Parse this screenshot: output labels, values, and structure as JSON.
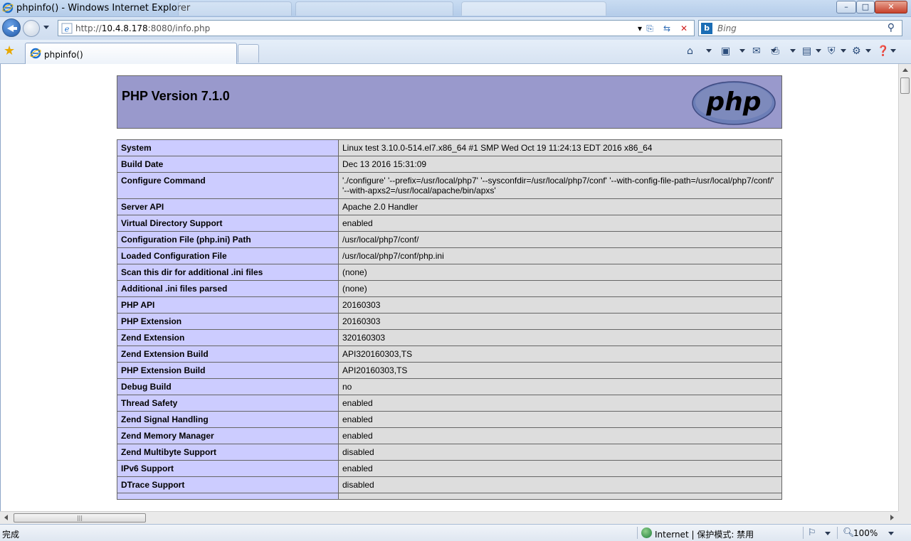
{
  "window": {
    "title": "phpinfo() - Windows Internet Explorer",
    "minimize": "–",
    "maximize": "□",
    "close": "✕"
  },
  "address_bar": {
    "url_prefix": "http://",
    "url_host": "10.4.8.178",
    "url_rest": ":8080/info.php"
  },
  "search": {
    "placeholder": "Bing",
    "provider_icon": "b"
  },
  "tabs": [
    {
      "label": "phpinfo()",
      "active": true
    }
  ],
  "page": {
    "php_version": "PHP Version 7.1.0",
    "logo_text": "php",
    "rows": [
      {
        "key": "System",
        "value": "Linux test 3.10.0-514.el7.x86_64 #1 SMP Wed Oct 19 11:24:13 EDT 2016 x86_64"
      },
      {
        "key": "Build Date",
        "value": "Dec 13 2016 15:31:09"
      },
      {
        "key": "Configure Command",
        "value": "'./configure' '--prefix=/usr/local/php7' '--sysconfdir=/usr/local/php7/conf' '--with-config-file-path=/usr/local/php7/conf/' '--with-apxs2=/usr/local/apache/bin/apxs'"
      },
      {
        "key": "Server API",
        "value": "Apache 2.0 Handler"
      },
      {
        "key": "Virtual Directory Support",
        "value": "enabled"
      },
      {
        "key": "Configuration File (php.ini) Path",
        "value": "/usr/local/php7/conf/"
      },
      {
        "key": "Loaded Configuration File",
        "value": "/usr/local/php7/conf/php.ini"
      },
      {
        "key": "Scan this dir for additional .ini files",
        "value": "(none)"
      },
      {
        "key": "Additional .ini files parsed",
        "value": "(none)"
      },
      {
        "key": "PHP API",
        "value": "20160303"
      },
      {
        "key": "PHP Extension",
        "value": "20160303"
      },
      {
        "key": "Zend Extension",
        "value": "320160303"
      },
      {
        "key": "Zend Extension Build",
        "value": "API320160303,TS"
      },
      {
        "key": "PHP Extension Build",
        "value": "API20160303,TS"
      },
      {
        "key": "Debug Build",
        "value": "no"
      },
      {
        "key": "Thread Safety",
        "value": "enabled"
      },
      {
        "key": "Zend Signal Handling",
        "value": "enabled"
      },
      {
        "key": "Zend Memory Manager",
        "value": "enabled"
      },
      {
        "key": "Zend Multibyte Support",
        "value": "disabled"
      },
      {
        "key": "IPv6 Support",
        "value": "enabled"
      },
      {
        "key": "DTrace Support",
        "value": "disabled"
      },
      {
        "key": "",
        "value": ""
      }
    ]
  },
  "statusbar": {
    "status": "完成",
    "zone": "Internet | 保护模式: 禁用",
    "zoom": "100%"
  },
  "colors": {
    "php_header": "#9999cc",
    "key_cell": "#ccccff",
    "value_cell": "#dddddd"
  }
}
